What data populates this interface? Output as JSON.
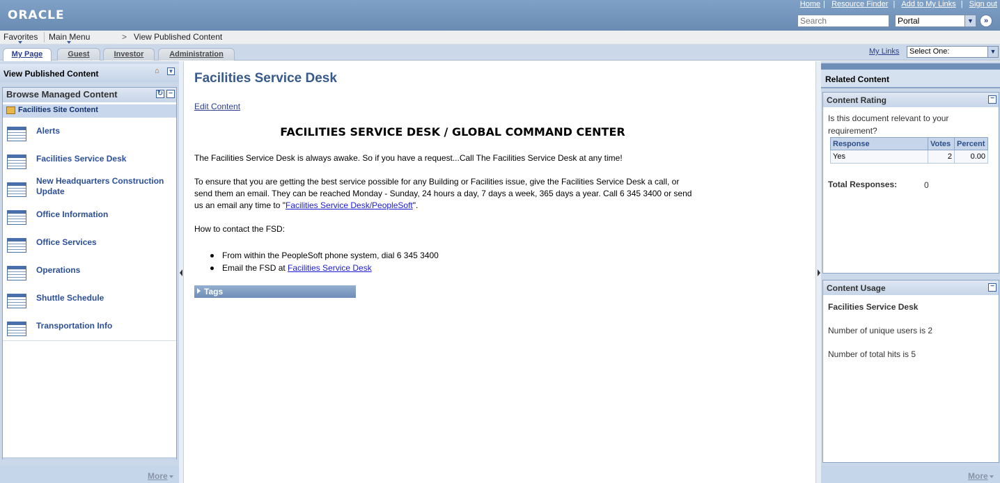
{
  "header": {
    "logo": "ORACLE",
    "links": [
      "Home",
      "Resource Finder",
      "Add to My Links",
      "Sign out"
    ],
    "search_placeholder": "Search",
    "portal_value": "Portal"
  },
  "nav": {
    "favorites": "Favorites",
    "main_menu": "Main Menu",
    "breadcrumb_sep": ">",
    "breadcrumb": "View Published Content"
  },
  "tabs": [
    "My Page",
    "Guest",
    "Investor",
    "Administration"
  ],
  "tabs_right": {
    "my_links": "My Links",
    "select_one": "Select One:"
  },
  "left": {
    "title": "View Published Content",
    "browse_title": "Browse Managed Content",
    "folder": "Facilities Site Content",
    "items": [
      "Alerts",
      "Facilities Service Desk",
      "New Headquarters Construction Update",
      "Office Information",
      "Office Services",
      "Operations",
      "Shuttle Schedule",
      "Transportation Info"
    ],
    "more": "More"
  },
  "main": {
    "title": "Facilities Service Desk",
    "edit_link": "Edit Content",
    "heading": "FACILITIES SERVICE DESK / GLOBAL COMMAND CENTER",
    "para1": "The Facilities Service Desk is always awake. So if you have a request...Call The Facilities Service Desk at any time!",
    "para2_text": "To ensure that you are getting the best service possible for any Building or Facilities issue, give the Facilities Service Desk a call, or send them an email. They can be reached Monday - Sunday, 24 hours a day, 7 days a week, 365 days a year. Call 6 345 3400 or send us an email any time to \"",
    "para2_link": "Facilities Service Desk/PeopleSoft",
    "para2_end": "\".",
    "para3": "How to contact the FSD:",
    "bullet1": "From within the PeopleSoft phone system, dial 6 345 3400",
    "bullet2_text": "Email the FSD at ",
    "bullet2_link": "Facilities Service Desk",
    "tags": "Tags"
  },
  "right": {
    "related": "Related Content",
    "rating_title": "Content Rating",
    "rating_question": "Is this document relevant to your requirement?",
    "rating_headers": [
      "Response",
      "Votes",
      "Percent"
    ],
    "rating_row": [
      "Yes",
      "2",
      "0.00"
    ],
    "total_label": "Total Responses:",
    "total_value": "0",
    "usage_title": "Content Usage",
    "usage_doc": "Facilities Service Desk",
    "unique_users": "Number of unique users is 2",
    "total_hits": "Number of total hits is 5",
    "more": "More"
  }
}
